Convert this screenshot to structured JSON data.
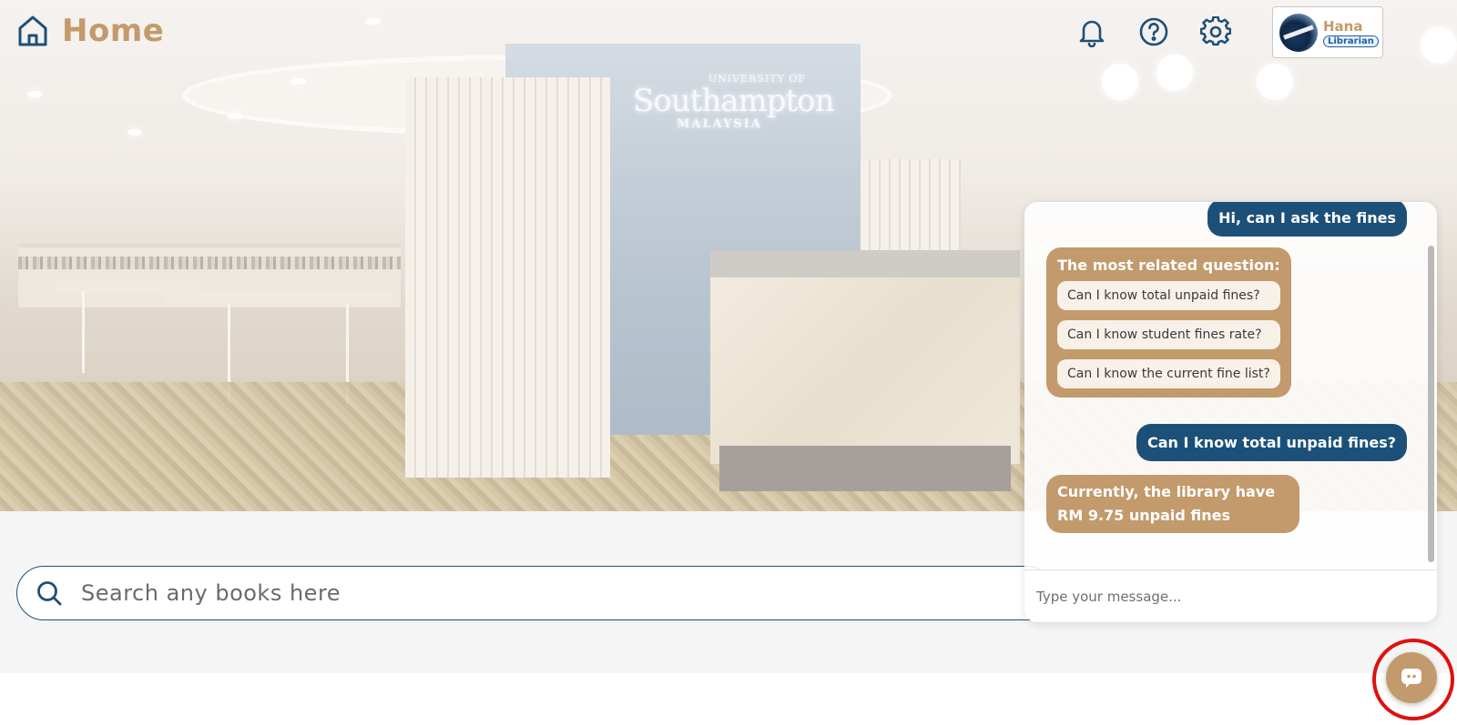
{
  "header": {
    "title": "Home",
    "home_icon": "home-icon",
    "icons": [
      "bell-icon",
      "help-icon",
      "gear-icon"
    ],
    "accent_color": "#c49a6c",
    "navy_color": "#1c5078"
  },
  "profile": {
    "name": "Hana",
    "role": "Librarian"
  },
  "hero": {
    "brand_small": "UNIVERSITY OF",
    "brand_big": "Southampton",
    "brand_sub": "MALAYSIA"
  },
  "search": {
    "placeholder": "Search any books here",
    "icon": "search-icon"
  },
  "chat": {
    "messages": [
      {
        "from": "user",
        "text": "Hi, can I ask the fines"
      },
      {
        "from": "bot",
        "heading": "The most related question:",
        "suggestions": [
          "Can I know total unpaid fines?",
          "Can I know student fines rate?",
          "Can I know the current fine list?"
        ]
      },
      {
        "from": "user",
        "text": "Can I know total unpaid fines?"
      },
      {
        "from": "bot",
        "text": "Currently, the library have RM 9.75 unpaid fines"
      }
    ],
    "input_placeholder": "Type your message...",
    "launcher_icon": "chat-bubble-icon"
  }
}
